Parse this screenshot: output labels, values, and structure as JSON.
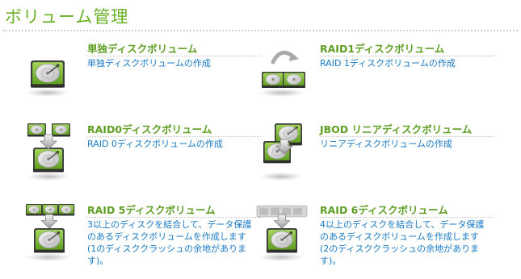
{
  "page_title": "ボリューム管理",
  "cards": [
    {
      "key": "single",
      "icon": "single-disk-icon",
      "title": "単独ディスクボリューム",
      "desc": "単独ディスクボリュームの作成"
    },
    {
      "key": "raid1",
      "icon": "raid1-mirror-icon",
      "title": "RAID1ディスクボリューム",
      "desc": "RAID 1ディスクボリュームの作成"
    },
    {
      "key": "raid0",
      "icon": "raid0-stripe-icon",
      "title": "RAID0ディスクボリューム",
      "desc": "RAID 0ディスクボリュームの作成"
    },
    {
      "key": "jbod",
      "icon": "jbod-linear-icon",
      "title": "JBOD リニアディスクボリューム",
      "desc": "リニアディスクボリュームの作成"
    },
    {
      "key": "raid5",
      "icon": "raid5-parity-icon",
      "title": "RAID 5ディスクボリューム",
      "desc": "3以上のディスクを結合して、データ保護のあるディスクボリュームを作成します(1のディスククラッシュの余地があります)。"
    },
    {
      "key": "raid6",
      "icon": "raid6-parity-icon",
      "title": "RAID 6ディスクボリューム",
      "desc": "4以上のディスクを結合して、データ保護のあるディスクボリュームを作成します(2のディスククラッシュの余地があります)。"
    }
  ],
  "colors": {
    "title_green": "#6ab024",
    "card_title_green": "#5e9e22",
    "link_blue": "#1a7ac4",
    "disk_green": "#7dbb2e"
  }
}
